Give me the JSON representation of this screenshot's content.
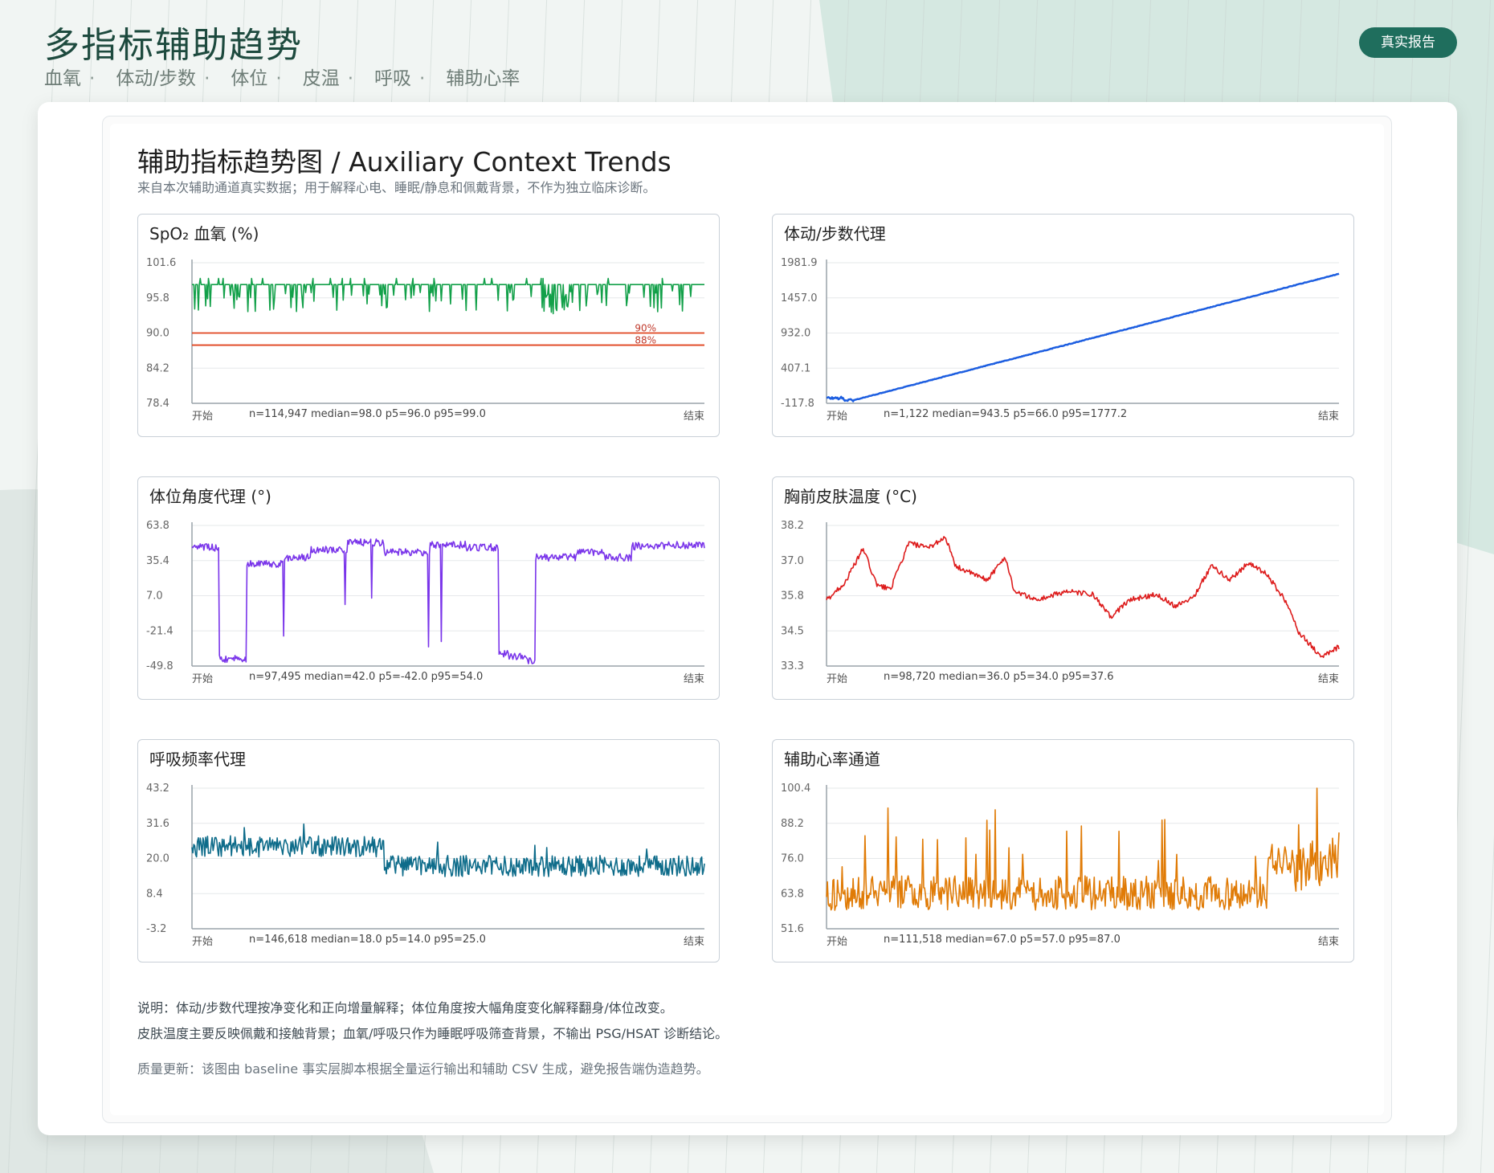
{
  "header": {
    "title": "多指标辅助趋势",
    "subtitle_items": [
      "血氧",
      "体动/步数",
      "体位",
      "皮温",
      "呼吸",
      "辅助心率"
    ],
    "separator": "·",
    "badge": "真实报告"
  },
  "report": {
    "title": "辅助指标趋势图 / Auxiliary Context Trends",
    "description": "来自本次辅助通道真实数据；用于解释心电、睡眠/静息和佩戴背景，不作为独立临床诊断。",
    "notes": [
      "说明：体动/步数代理按净变化和正向增量解释；体位角度按大幅角度变化解释翻身/体位改变。",
      "皮肤温度主要反映佩戴和接触背景；血氧/呼吸只作为睡眠呼吸筛查背景，不输出 PSG/HSAT 诊断结论。"
    ],
    "quality_note": "质量更新：该图由 baseline 事实层脚本根据全量运行输出和辅助 CSV 生成，避免报告端伪造趋势。"
  },
  "colors": {
    "accent": "#1f6e5d",
    "spo2": "#12a049",
    "steps": "#1d5ee0",
    "posture": "#7a35ea",
    "temp": "#dd1b1b",
    "resp": "#0e6c8a",
    "hr": "#e07b06",
    "threshold": "#e0451f"
  },
  "chart_data": [
    {
      "type": "line",
      "title": "SpO₂ 血氧 (%)",
      "xlabel": "",
      "ylabel": "",
      "x_start_label": "开始",
      "x_end_label": "结束",
      "ylim": [
        78.4,
        101.6
      ],
      "yticks": [
        "101.6",
        "95.8",
        "90.0",
        "84.2",
        "78.4"
      ],
      "stats": "n=114,947  median=98.0  p5=96.0  p95=99.0",
      "reference_lines": [
        {
          "value": 90,
          "label": "90%"
        },
        {
          "value": 88,
          "label": "88%"
        }
      ],
      "series": [
        {
          "color": "#12a049",
          "pattern": "baseline 98 with dips to ~93"
        }
      ],
      "grid": true,
      "legend": "none"
    },
    {
      "type": "line",
      "title": "体动/步数代理",
      "x_start_label": "开始",
      "x_end_label": "结束",
      "ylim": [
        -117.8,
        1981.9
      ],
      "yticks": [
        "1981.9",
        "1457.0",
        "932.0",
        "407.1",
        "-117.8"
      ],
      "stats": "n=1,122  median=943.5  p5=66.0  p95=1777.2",
      "series": [
        {
          "color": "#1d5ee0",
          "start": -50,
          "end": 1820
        }
      ],
      "grid": true,
      "legend": "none"
    },
    {
      "type": "line",
      "title": "体位角度代理 (°)",
      "x_start_label": "开始",
      "x_end_label": "结束",
      "ylim": [
        -49.8,
        63.8
      ],
      "yticks": [
        "63.8",
        "35.4",
        "7.0",
        "-21.4",
        "-49.8"
      ],
      "stats": "n=97,495  median=42.0  p5=-42.0  p95=54.0",
      "series": [
        {
          "color": "#7a35ea"
        }
      ],
      "grid": true,
      "legend": "none"
    },
    {
      "type": "line",
      "title": "胸前皮肤温度 (°C)",
      "x_start_label": "开始",
      "x_end_label": "结束",
      "ylim": [
        33.3,
        38.2
      ],
      "yticks": [
        "38.2",
        "37.0",
        "35.8",
        "34.5",
        "33.3"
      ],
      "stats": "n=98,720  median=36.0  p5=34.0  p95=37.6",
      "series": [
        {
          "color": "#dd1b1b"
        }
      ],
      "grid": true,
      "legend": "none"
    },
    {
      "type": "line",
      "title": "呼吸频率代理",
      "x_start_label": "开始",
      "x_end_label": "结束",
      "ylim": [
        -3.2,
        43.2
      ],
      "yticks": [
        "43.2",
        "31.6",
        "20.0",
        "8.4",
        "-3.2"
      ],
      "stats": "n=146,618  median=18.0  p5=14.0  p95=25.0",
      "series": [
        {
          "color": "#0e6c8a"
        }
      ],
      "grid": true,
      "legend": "none"
    },
    {
      "type": "line",
      "title": "辅助心率通道",
      "x_start_label": "开始",
      "x_end_label": "结束",
      "ylim": [
        51.6,
        100.4
      ],
      "yticks": [
        "100.4",
        "88.2",
        "76.0",
        "63.8",
        "51.6"
      ],
      "stats": "n=111,518  median=67.0  p5=57.0  p95=87.0",
      "series": [
        {
          "color": "#e07b06"
        }
      ],
      "grid": true,
      "legend": "none"
    }
  ]
}
